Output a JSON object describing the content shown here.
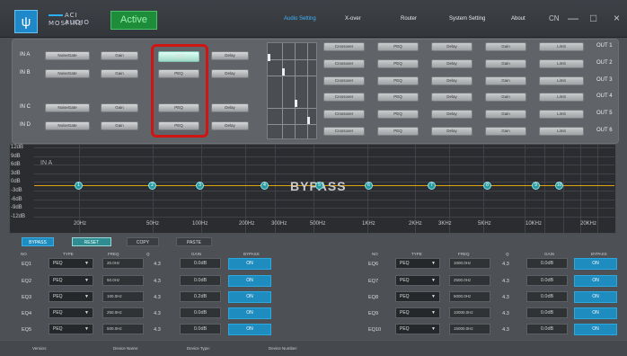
{
  "app": {
    "brand_line1": "ACI AUDIO",
    "brand_line2": "MOSFIRE",
    "logo_glyph": "ψ",
    "status": "Active"
  },
  "nav": {
    "items": [
      "Audio Setting",
      "X-over",
      "Router",
      "System Setting",
      "About"
    ],
    "active": "Audio Setting",
    "lang": "CN",
    "minimize": "—",
    "maximize": "□",
    "close": "×"
  },
  "colors": {
    "accent": "#3fb4ff",
    "active_green": "#1d8d3a",
    "curve": "#e0a40c",
    "on_button": "#1f8cc0",
    "highlight_red": "#d01414"
  },
  "inputs": [
    {
      "label": "IN A",
      "noisegate": "NoiseGate",
      "gain": "Gain",
      "peq": "PEQ",
      "delay": "Delay"
    },
    {
      "label": "IN B",
      "noisegate": "NoiseGate",
      "gain": "Gain",
      "peq": "PEQ",
      "delay": "Delay"
    },
    {
      "label": "IN C",
      "noisegate": "NoiseGate",
      "gain": "Gain",
      "peq": "PEQ",
      "delay": "Delay"
    },
    {
      "label": "IN D",
      "noisegate": "NoiseGate",
      "gain": "Gain",
      "peq": "PEQ",
      "delay": "Delay"
    }
  ],
  "outputs": [
    {
      "label": "OUT 1",
      "crossover": "Crossover",
      "peq": "PEQ",
      "delay": "Delay",
      "gain": "Gain",
      "limit": "Limit"
    },
    {
      "label": "OUT 2",
      "crossover": "Crossover",
      "peq": "PEQ",
      "delay": "Delay",
      "gain": "Gain",
      "limit": "Limit"
    },
    {
      "label": "OUT 3",
      "crossover": "Crossover",
      "peq": "PEQ",
      "delay": "Delay",
      "gain": "Gain",
      "limit": "Limit"
    },
    {
      "label": "OUT 4",
      "crossover": "Crossover",
      "peq": "PEQ",
      "delay": "Delay",
      "gain": "Gain",
      "limit": "Limit"
    },
    {
      "label": "OUT 5",
      "crossover": "Crossover",
      "peq": "PEQ",
      "delay": "Delay",
      "gain": "Gain",
      "limit": "Limit"
    },
    {
      "label": "OUT 6",
      "crossover": "Crossover",
      "peq": "PEQ",
      "delay": "Delay",
      "gain": "Gain",
      "limit": "Limit"
    }
  ],
  "graph": {
    "y_labels": [
      "12dB",
      "9dB",
      "6dB",
      "3dB",
      "0dB",
      "-3dB",
      "-6dB",
      "-9dB",
      "-12dB"
    ],
    "x_labels": [
      "20Hz",
      "50Hz",
      "100Hz",
      "200Hz",
      "300Hz",
      "500Hz",
      "1KHz",
      "2KHz",
      "3KHz",
      "5KHz",
      "10KHz",
      "20KHz"
    ],
    "channel": "IN A",
    "overlay": "BYPASS",
    "nodes": [
      "1",
      "2",
      "3",
      "4",
      "5",
      "6",
      "7",
      "8",
      "9",
      "10"
    ]
  },
  "controls": {
    "bypass": "BYPASS",
    "reset": "RESET",
    "copy": "COPY",
    "paste": "PASTE"
  },
  "table": {
    "headers": [
      "NO",
      "TYPE",
      "FREQ",
      "Q",
      "GAIN",
      "BYPASS"
    ],
    "left": [
      {
        "no": "EQ1",
        "type": "PEQ",
        "freq": "20.0Hz",
        "q": "4.3",
        "gain": "0.0dB",
        "bypass": "ON"
      },
      {
        "no": "EQ2",
        "type": "PEQ",
        "freq": "50.0Hz",
        "q": "4.3",
        "gain": "0.0dB",
        "bypass": "ON"
      },
      {
        "no": "EQ3",
        "type": "PEQ",
        "freq": "100.0Hz",
        "q": "4.3",
        "gain": "0.2dB",
        "bypass": "ON"
      },
      {
        "no": "EQ4",
        "type": "PEQ",
        "freq": "250.0Hz",
        "q": "4.3",
        "gain": "0.0dB",
        "bypass": "ON"
      },
      {
        "no": "EQ5",
        "type": "PEQ",
        "freq": "500.0Hz",
        "q": "4.3",
        "gain": "0.0dB",
        "bypass": "ON"
      }
    ],
    "right": [
      {
        "no": "EQ6",
        "type": "PEQ",
        "freq": "1000.0Hz",
        "q": "4.3",
        "gain": "0.0dB",
        "bypass": "ON"
      },
      {
        "no": "EQ7",
        "type": "PEQ",
        "freq": "2500.0Hz",
        "q": "4.3",
        "gain": "0.0dB",
        "bypass": "ON"
      },
      {
        "no": "EQ8",
        "type": "PEQ",
        "freq": "5000.0Hz",
        "q": "4.3",
        "gain": "0.0dB",
        "bypass": "ON"
      },
      {
        "no": "EQ9",
        "type": "PEQ",
        "freq": "10000.0Hz",
        "q": "4.3",
        "gain": "0.0dB",
        "bypass": "ON"
      },
      {
        "no": "EQ10",
        "type": "PEQ",
        "freq": "15000.0Hz",
        "q": "4.3",
        "gain": "0.0dB",
        "bypass": "ON"
      }
    ]
  },
  "footer": {
    "version": "Version:",
    "device_name": "Device Name:",
    "device_type": "Device Type:",
    "device_number": "Device Number:"
  }
}
